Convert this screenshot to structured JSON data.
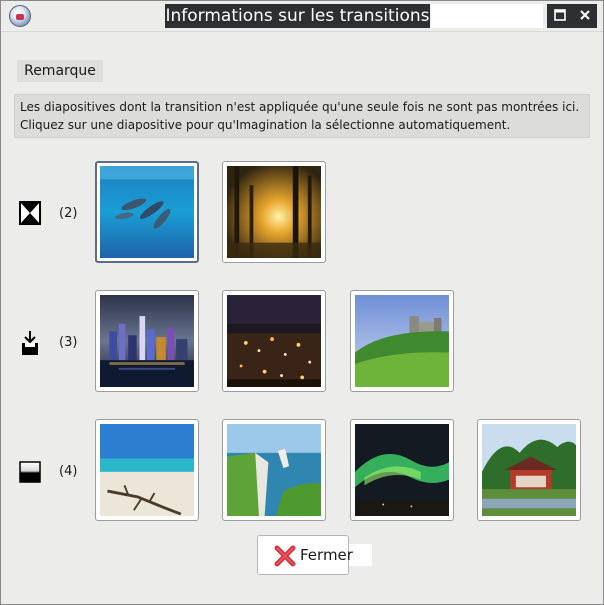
{
  "window": {
    "title": "Informations sur les transitions"
  },
  "remark": {
    "label": "Remarque",
    "lines": [
      "Les diapositives dont la transition n'est appliquée qu'une seule fois ne sont pas montrées ici.",
      "Cliquez sur une diapositive pour qu'Imagination la sélectionne automatiquement."
    ]
  },
  "transitions": [
    {
      "icon": "hourglass-icon",
      "count": "(2)",
      "slides": [
        "dolphins-underwater",
        "sunlit-forest"
      ]
    },
    {
      "icon": "push-down-icon",
      "count": "(3)",
      "slides": [
        "hong-kong-skyline-night",
        "city-lights-night",
        "castle-on-hill"
      ]
    },
    {
      "icon": "gradient-wipe-icon",
      "count": "(4)",
      "slides": [
        "beach-driftwood",
        "etretat-cliffs",
        "aurora-borealis",
        "temple-mountains"
      ]
    }
  ],
  "close_button": {
    "label": "Fermer"
  },
  "colors": {
    "title_bg": "#2d2f33",
    "window_bg": "#ececea",
    "close_red": "#d9323f"
  }
}
